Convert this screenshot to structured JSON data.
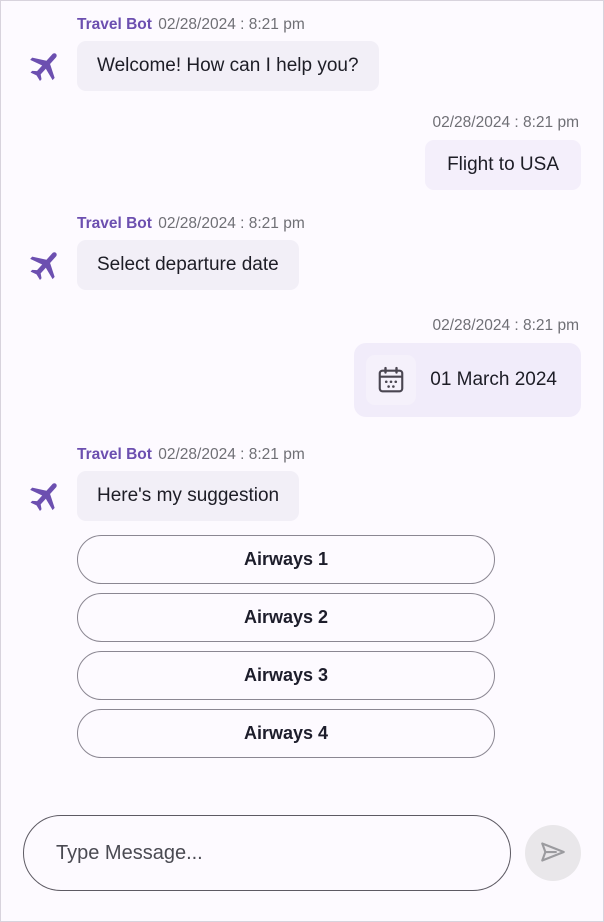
{
  "theme": {
    "background": "#fdfaff",
    "frame_border": "#d8d3dd",
    "bot_name_color": "#6c4fb0",
    "bot_bubble_bg": "#f2eff7",
    "user_bubble_bg": "#f4effb",
    "chip_bg": "#f1ecfa",
    "accent": "#6c4fb0",
    "timestamp_color": "#6f6f75",
    "send_button_bg": "#e9e7ea",
    "send_icon_color": "#9b9b9f"
  },
  "bot": {
    "name": "Travel Bot",
    "avatar_icon": "airplane-icon"
  },
  "messages": [
    {
      "sender": "bot",
      "name": "Travel Bot",
      "timestamp": "02/28/2024 : 8:21 pm",
      "text": "Welcome! How can I help you?"
    },
    {
      "sender": "user",
      "timestamp": "02/28/2024 : 8:21 pm",
      "text": "Flight to USA"
    },
    {
      "sender": "bot",
      "name": "Travel Bot",
      "timestamp": "02/28/2024 : 8:21 pm",
      "text": "Select departure date"
    },
    {
      "sender": "user",
      "timestamp": "02/28/2024 : 8:21 pm",
      "text": "01 March 2024",
      "type": "date-chip",
      "icon": "calendar-icon"
    },
    {
      "sender": "bot",
      "name": "Travel Bot",
      "timestamp": "02/28/2024 : 8:21 pm",
      "text": "Here's my suggestion"
    }
  ],
  "options": [
    {
      "label": "Airways 1"
    },
    {
      "label": "Airways 2"
    },
    {
      "label": "Airways 3"
    },
    {
      "label": "Airways 4"
    }
  ],
  "composer": {
    "placeholder": "Type Message...",
    "value": "",
    "send_icon": "send-icon"
  }
}
